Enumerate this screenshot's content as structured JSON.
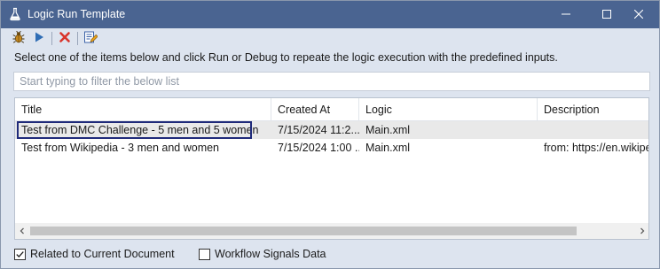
{
  "window": {
    "title": "Logic Run Template",
    "icon": "flask-icon",
    "controls": [
      "minimize-icon",
      "maximize-icon",
      "close-icon"
    ]
  },
  "toolbar": {
    "buttons": [
      {
        "name": "debug-button",
        "icon": "bug-icon"
      },
      {
        "name": "run-button",
        "icon": "play-icon"
      },
      {
        "name": "delete-button",
        "icon": "delete-x-icon"
      },
      {
        "name": "edit-button",
        "icon": "edit-icon"
      }
    ]
  },
  "instruction": "Select one of the items below and click Run or Debug to repeate the logic execution with the predefined inputs.",
  "filter": {
    "placeholder": "Start typing to filter the below list",
    "value": ""
  },
  "table": {
    "columns": [
      "Title",
      "Created At",
      "Logic",
      "Description"
    ],
    "rows": [
      {
        "title": "Test from DMC Challenge - 5 men and 5 women",
        "created": "7/15/2024 11:2...",
        "logic": "Main.xml",
        "description": ""
      },
      {
        "title": "Test from Wikipedia - 3 men and women",
        "created": "7/15/2024 1:00 ...",
        "logic": "Main.xml",
        "description": "from: https://en.wikipe"
      }
    ],
    "selected_row": 0
  },
  "options": {
    "related_label": "Related to Current Document",
    "related_checked": true,
    "workflow_label": "Workflow Signals Data",
    "workflow_checked": false
  },
  "colors": {
    "titlebar": "#4a6491",
    "window_bg": "#dde4ef",
    "selected_row": "#e9e9e9",
    "focus_border": "#1f2a7a"
  }
}
